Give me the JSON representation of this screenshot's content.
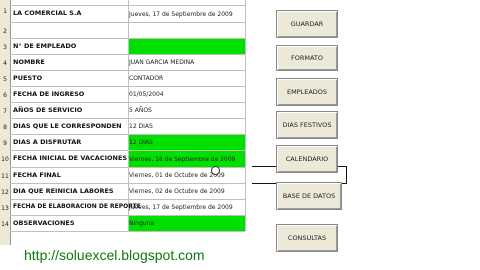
{
  "row_numbers": [
    "1",
    "2",
    "3",
    "4",
    "5",
    "6",
    "7",
    "8",
    "9",
    "10",
    "11",
    "12",
    "13",
    "14"
  ],
  "rows": [
    {
      "label": "LA COMERCIAL S.A",
      "value": "Jueves, 17 de Septiembre de 2009",
      "green": false
    },
    {
      "label": "",
      "value": "",
      "green": false
    },
    {
      "label": "N° DE EMPLEADO",
      "value": "",
      "green": true
    },
    {
      "label": "NOMBRE",
      "value": "JUAN GARCIA MEDINA",
      "green": false
    },
    {
      "label": "PUESTO",
      "value": "CONTADOR",
      "green": false
    },
    {
      "label": "FECHA DE INGRESO",
      "value": "01/05/2004",
      "green": false
    },
    {
      "label": "AÑOS DE SERVICIO",
      "value": "5 AÑOS",
      "green": false
    },
    {
      "label": "DIAS QUE LE CORRESPONDEN",
      "value": "12 DIAS",
      "green": false
    },
    {
      "label": "DIAS A DISFRUTAR",
      "value": "12 DIAS",
      "green": true
    },
    {
      "label": "FECHA INICIAL DE VACACIONES",
      "value": "Viernes, 18 de Septiembre de 2009",
      "green": true
    },
    {
      "label": "FECHA FINAL",
      "value": "Viernes, 01 de Octubre de 2009",
      "green": false
    },
    {
      "label": "DIA QUE REINICIA LABORES",
      "value": "Viernes, 02 de Octubre de 2009",
      "green": false
    },
    {
      "label": "FECHA DE ELABORACION DE REPORTE",
      "value": "Jueves, 17 de Septiembre de 2009",
      "green": false
    },
    {
      "label": "OBSERVACIONES",
      "value": "Ninguna",
      "green": true
    }
  ],
  "buttons": {
    "guardar": "GUARDAR",
    "formato": "FORMATO",
    "empleados": "EMPLEADOS",
    "dias_festivos": "DIAS FESTIVOS",
    "calendario": "CALENDARIO",
    "base_datos": "BASE DE DATOS",
    "consultas": "CONSULTAS"
  },
  "footer_link": "http://soluexcel.blogspot.com"
}
